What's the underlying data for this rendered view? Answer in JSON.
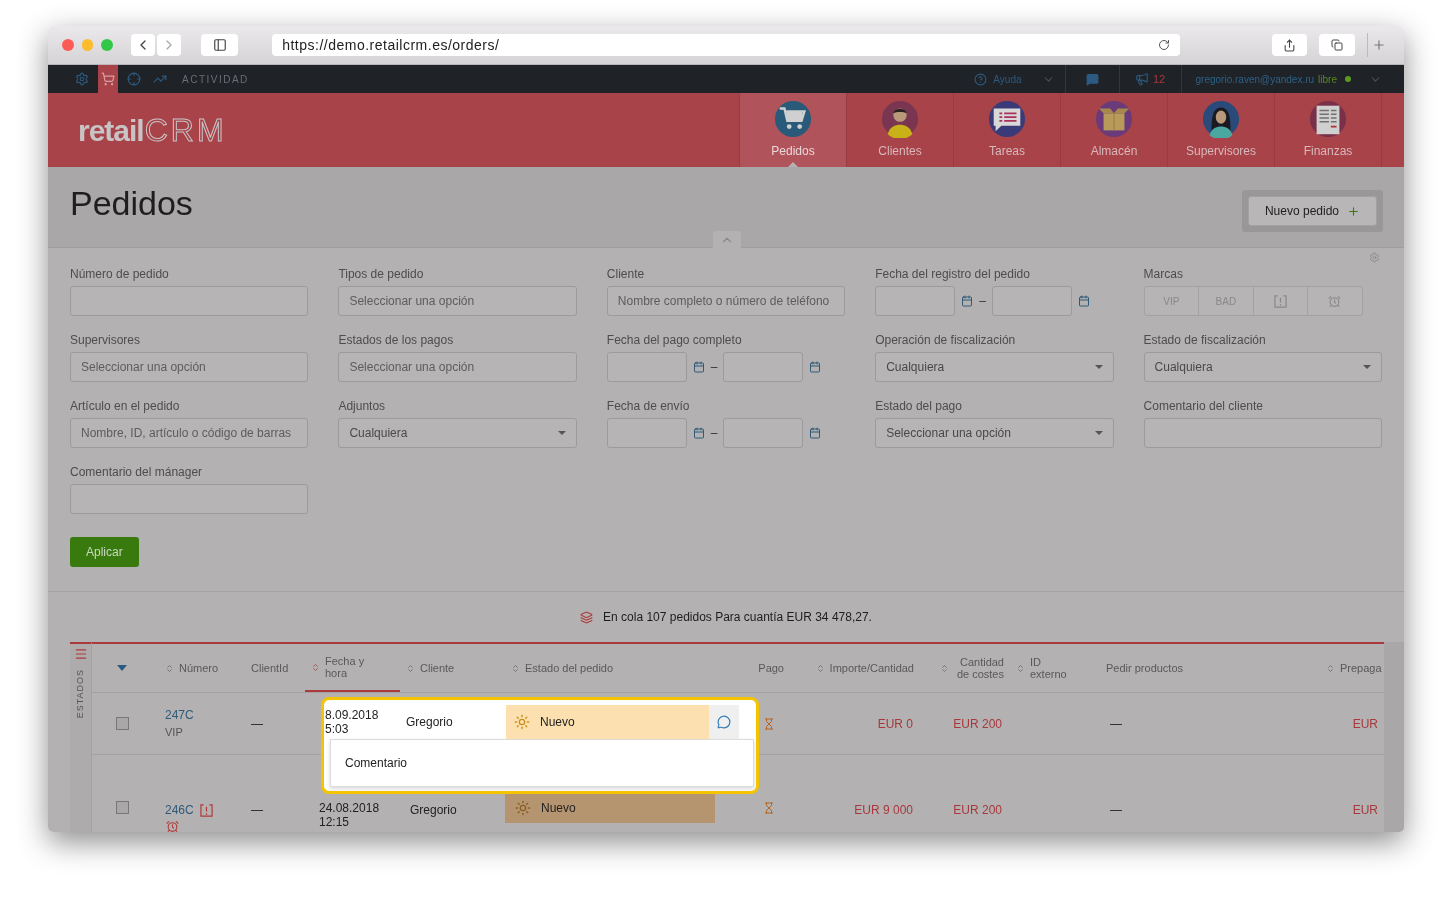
{
  "browser": {
    "url": "https://demo.retailcrm.es/orders/"
  },
  "topbar": {
    "tools": [
      {
        "kind": "settings",
        "selected": false
      },
      {
        "kind": "orders",
        "selected": true
      },
      {
        "kind": "target",
        "selected": false
      },
      {
        "kind": "analytics",
        "selected": false
      }
    ],
    "activity": "ACTIVIDAD",
    "help": "Ayuda",
    "notifications": "12",
    "user_email": "gregorio.raven@yandex.ru",
    "user_status": "libre",
    "online": true
  },
  "logo": {
    "main": "retail",
    "suffix": "CRM"
  },
  "nav": [
    {
      "kind": "orders",
      "label": "Pedidos",
      "selected": true
    },
    {
      "kind": "customers",
      "label": "Clientes",
      "selected": false
    },
    {
      "kind": "tasks",
      "label": "Tareas",
      "selected": false
    },
    {
      "kind": "warehouse",
      "label": "Almacén",
      "selected": false
    },
    {
      "kind": "managers",
      "label": "Supervisores",
      "selected": false
    },
    {
      "kind": "finance",
      "label": "Finanzas",
      "selected": false
    }
  ],
  "page": {
    "title": "Pedidos",
    "new_button": "Nuevo pedido"
  },
  "filters": [
    {
      "kind": "text",
      "label": "Número de pedido"
    },
    {
      "kind": "text",
      "label": "Tipos de pedido",
      "placeholder": "Seleccionar una opción"
    },
    {
      "kind": "text",
      "label": "Cliente",
      "placeholder": "Nombre completo o número de teléfono"
    },
    {
      "kind": "daterange",
      "label": "Fecha del registro del pedido",
      "separator": "–"
    },
    {
      "kind": "tags",
      "label": "Marcas",
      "options": [
        {
          "kind": "text",
          "label": "VIP",
          "selected": false
        },
        {
          "kind": "text",
          "label": "BAD",
          "selected": false
        },
        {
          "kind": "flag",
          "selected": false
        },
        {
          "kind": "alarm",
          "selected": false
        }
      ]
    },
    {
      "kind": "text",
      "label": "Supervisores",
      "placeholder": "Seleccionar una opción"
    },
    {
      "kind": "text",
      "label": "Estados de los pagos",
      "placeholder": "Seleccionar una opción"
    },
    {
      "kind": "daterange",
      "label": "Fecha del pago completo",
      "separator": "–"
    },
    {
      "kind": "dropdown",
      "label": "Operación de fiscalización",
      "value": "Cualquiera"
    },
    {
      "kind": "dropdown",
      "label": "Estado de fiscalización",
      "value": "Cualquiera"
    },
    {
      "kind": "text",
      "label": "Artículo en el pedido",
      "placeholder": "Nombre, ID, artículo o código de barras"
    },
    {
      "kind": "dropdown",
      "label": "Adjuntos",
      "value": "Cualquiera"
    },
    {
      "kind": "daterange",
      "label": "Fecha de envío",
      "separator": "–"
    },
    {
      "kind": "dropdown",
      "label": "Estado del pago",
      "value": "Seleccionar una opción"
    },
    {
      "kind": "text",
      "label": "Comentario del cliente"
    },
    {
      "kind": "text",
      "label": "Comentario del mánager"
    }
  ],
  "apply_button": "Aplicar",
  "summary": "En cola 107 pedidos Para cuantía EUR 34 478,27.",
  "table": {
    "side_label": "ESTADOS",
    "columns": [
      {
        "label": "Número",
        "sortable": true,
        "sorted": false
      },
      {
        "label": "ClientId",
        "sortable": false,
        "sorted": false
      },
      {
        "label": "Fecha y hora",
        "sortable": true,
        "sorted": true
      },
      {
        "label": "Cliente",
        "sortable": true,
        "sorted": false
      },
      {
        "label": "Estado del pedido",
        "sortable": true,
        "sorted": false
      },
      {
        "label": "Pago",
        "sortable": false,
        "sorted": false
      },
      {
        "label": "Importe/Cantidad",
        "sortable": true,
        "sorted": false
      },
      {
        "label": "Cantidad de costes",
        "sortable": true,
        "sorted": false
      },
      {
        "label": "ID externo",
        "sortable": true,
        "sorted": false
      },
      {
        "label": "Pedir productos",
        "sortable": false,
        "sorted": false
      },
      {
        "label": "Prepaga",
        "sortable": true,
        "sorted": false
      }
    ],
    "rows": [
      {
        "checked": false,
        "highlighted": true,
        "number": "247C",
        "tag": "VIP",
        "client_id": "—",
        "date": "8.09.2018",
        "time": "5:03",
        "client": "Gregorio",
        "status": "Nuevo",
        "amount": "EUR 0",
        "costs": "EUR 200",
        "products": "—",
        "prepaid": "EUR"
      },
      {
        "checked": false,
        "highlighted": false,
        "number": "246C",
        "marks": [
          {
            "kind": "flag"
          },
          {
            "kind": "alarm"
          }
        ],
        "client_id": "—",
        "date": "24.08.2018",
        "time": "12:15",
        "client": "Gregorio",
        "status": "Nuevo",
        "amount": "EUR 9 000",
        "costs": "EUR 200",
        "products": "—",
        "prepaid": "EUR"
      }
    ]
  },
  "popover": {
    "text": "Comentario"
  }
}
